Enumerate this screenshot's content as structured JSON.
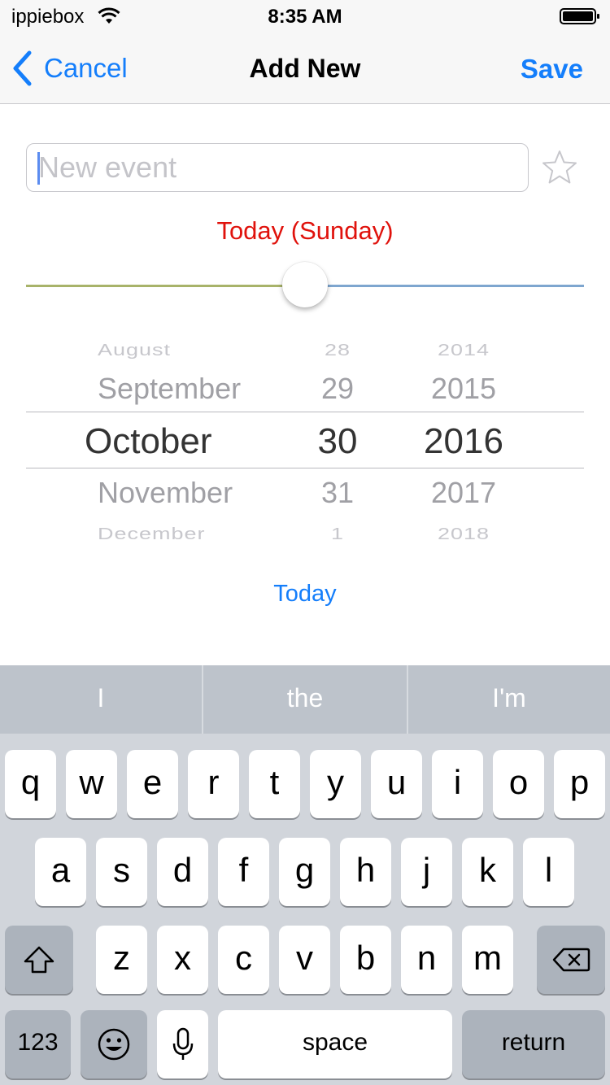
{
  "status_bar": {
    "carrier": "ippiebox",
    "time": "8:35 AM"
  },
  "nav": {
    "back_label": "Cancel",
    "title": "Add New",
    "save_label": "Save"
  },
  "event_field": {
    "placeholder": "New event",
    "value": ""
  },
  "date_label": "Today (Sunday)",
  "slider": {
    "position_fraction": 0.5
  },
  "picker": {
    "months": [
      "August",
      "September",
      "October",
      "November",
      "December"
    ],
    "days": [
      "28",
      "29",
      "30",
      "31",
      "1"
    ],
    "years": [
      "2014",
      "2015",
      "2016",
      "2017",
      "2018"
    ],
    "selected": {
      "month": "October",
      "day": "30",
      "year": "2016"
    }
  },
  "today_button": "Today",
  "keyboard": {
    "suggestions": [
      "I",
      "the",
      "I'm"
    ],
    "row1": [
      "q",
      "w",
      "e",
      "r",
      "t",
      "y",
      "u",
      "i",
      "o",
      "p"
    ],
    "row2": [
      "a",
      "s",
      "d",
      "f",
      "g",
      "h",
      "j",
      "k",
      "l"
    ],
    "row3": [
      "z",
      "x",
      "c",
      "v",
      "b",
      "n",
      "m"
    ],
    "numbers_label": "123",
    "space_label": "space",
    "return_label": "return"
  },
  "colors": {
    "accent": "#147efb",
    "date_label": "#e0120c",
    "slider_left": "#a8b36a",
    "slider_right": "#7ea6cf"
  },
  "icons": [
    "wifi-icon",
    "battery-icon",
    "chevron-left-icon",
    "star-icon",
    "shift-icon",
    "delete-icon",
    "emoji-icon",
    "microphone-icon"
  ]
}
